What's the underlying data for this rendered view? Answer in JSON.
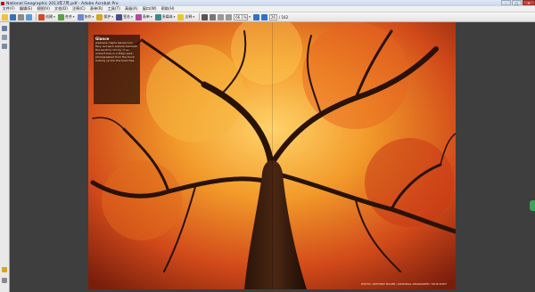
{
  "window": {
    "title": "National Geographic 2013年7月.pdf - Adobe Acrobat Pro",
    "buttons": {
      "minimize": "–",
      "maximize": "□",
      "close": "✕"
    }
  },
  "menu": [
    "文件(F)",
    "编辑(E)",
    "视图(V)",
    "文档(D)",
    "注释(C)",
    "表单(R)",
    "工具(T)",
    "高级(A)",
    "窗口(W)",
    "帮助(H)"
  ],
  "toolbar": {
    "create_label": "创建",
    "combine_label": "合并",
    "collaborate_label": "协作",
    "secure_label": "保护",
    "sign_label": "签名",
    "forms_label": "表单",
    "multimedia_label": "多媒体",
    "comment_label": "注释",
    "zoom_value": "66.1%",
    "page_current": "26",
    "page_total": "/ 162"
  },
  "document": {
    "caption_title": "Glance",
    "caption_body": "Japanese maple leaves turn fiery red each autumn beneath the twisting canopy of an ancient tree in a Tokyo park, photographed from the trunk looking up into the branches.",
    "credit": "PHOTO: ANTHONY BAUER / NATIONAL GEOGRAPHIC YOUR SHOT"
  },
  "colors": {
    "titlebar": "#c6d6ea",
    "accent": "#b50d0d",
    "background": "#3a3a3a"
  }
}
